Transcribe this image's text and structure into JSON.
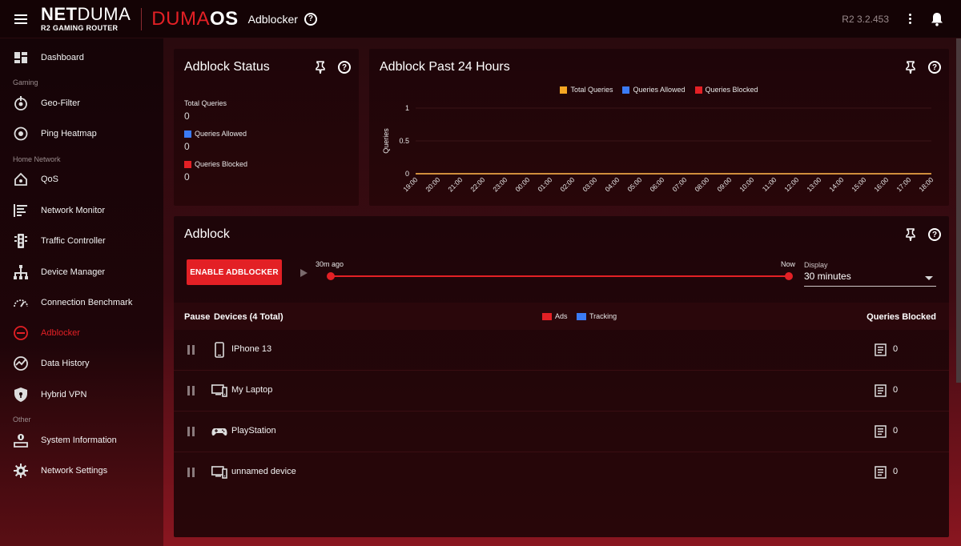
{
  "header": {
    "brand_bold": "NET",
    "brand_light": "DUMA",
    "brand_sub": "R2 GAMING ROUTER",
    "os_red": "DUMA",
    "os_white": "OS",
    "page_title": "Adblocker",
    "version": "R2 3.2.453"
  },
  "sidebar": {
    "items": [
      {
        "label": "Dashboard",
        "icon": "dashboard-icon"
      },
      {
        "label": "Geo-Filter",
        "icon": "geo-filter-icon"
      },
      {
        "label": "Ping Heatmap",
        "icon": "ping-heatmap-icon"
      },
      {
        "label": "QoS",
        "icon": "qos-icon"
      },
      {
        "label": "Network Monitor",
        "icon": "network-monitor-icon"
      },
      {
        "label": "Traffic Controller",
        "icon": "traffic-controller-icon"
      },
      {
        "label": "Device Manager",
        "icon": "device-manager-icon"
      },
      {
        "label": "Connection Benchmark",
        "icon": "benchmark-icon"
      },
      {
        "label": "Adblocker",
        "icon": "adblocker-icon",
        "active": true
      },
      {
        "label": "Data History",
        "icon": "data-history-icon"
      },
      {
        "label": "Hybrid VPN",
        "icon": "vpn-shield-icon"
      },
      {
        "label": "System Information",
        "icon": "system-info-icon"
      },
      {
        "label": "Network Settings",
        "icon": "gear-icon"
      }
    ],
    "sections": [
      "Gaming",
      "Home Network",
      "Other"
    ]
  },
  "status_card": {
    "title": "Adblock Status",
    "total_label": "Total Queries",
    "total_value": "0",
    "allowed_label": "Queries Allowed",
    "allowed_value": "0",
    "blocked_label": "Queries Blocked",
    "blocked_value": "0"
  },
  "chart_card": {
    "title": "Adblock Past 24 Hours"
  },
  "chart_data": {
    "type": "line",
    "ylabel": "Queries",
    "xlabel": "",
    "ylim": [
      0,
      1
    ],
    "yticks": [
      "1",
      "0.5",
      "0"
    ],
    "x": [
      "19:00",
      "20:00",
      "21:00",
      "22:00",
      "23:00",
      "00:00",
      "01:00",
      "02:00",
      "03:00",
      "04:00",
      "05:00",
      "06:00",
      "07:00",
      "08:00",
      "09:00",
      "10:00",
      "11:00",
      "12:00",
      "13:00",
      "14:00",
      "15:00",
      "16:00",
      "17:00",
      "18:00"
    ],
    "series": [
      {
        "name": "Total Queries",
        "color": "#f5a623",
        "values": [
          0,
          0,
          0,
          0,
          0,
          0,
          0,
          0,
          0,
          0,
          0,
          0,
          0,
          0,
          0,
          0,
          0,
          0,
          0,
          0,
          0,
          0,
          0,
          0
        ]
      },
      {
        "name": "Queries Allowed",
        "color": "#3b7bf5",
        "values": [
          0,
          0,
          0,
          0,
          0,
          0,
          0,
          0,
          0,
          0,
          0,
          0,
          0,
          0,
          0,
          0,
          0,
          0,
          0,
          0,
          0,
          0,
          0,
          0
        ]
      },
      {
        "name": "Queries Blocked",
        "color": "#e32025",
        "values": [
          0,
          0,
          0,
          0,
          0,
          0,
          0,
          0,
          0,
          0,
          0,
          0,
          0,
          0,
          0,
          0,
          0,
          0,
          0,
          0,
          0,
          0,
          0,
          0
        ]
      }
    ],
    "legend": "top-center",
    "grid": true
  },
  "adblock_card": {
    "title": "Adblock",
    "enable_button": "ENABLE ADBLOCKER",
    "slider_start": "30m ago",
    "slider_end": "Now",
    "display_label": "Display",
    "display_value": "30 minutes",
    "col_pause": "Pause",
    "col_devices": "Devices (4 Total)",
    "legend_ads": "Ads",
    "legend_tracking": "Tracking",
    "col_blocked": "Queries Blocked",
    "devices": [
      {
        "name": "IPhone 13",
        "icon": "phone-icon",
        "blocked": "0"
      },
      {
        "name": "My Laptop",
        "icon": "computer-icon",
        "blocked": "0"
      },
      {
        "name": "PlayStation",
        "icon": "gamepad-icon",
        "blocked": "0"
      },
      {
        "name": "unnamed device",
        "icon": "computer-icon",
        "blocked": "0"
      }
    ]
  },
  "colors": {
    "accent": "#e32025",
    "total": "#f5a623",
    "allowed": "#3b7bf5",
    "blocked": "#e32025",
    "ads": "#e32025",
    "tracking": "#3b7bf5"
  }
}
